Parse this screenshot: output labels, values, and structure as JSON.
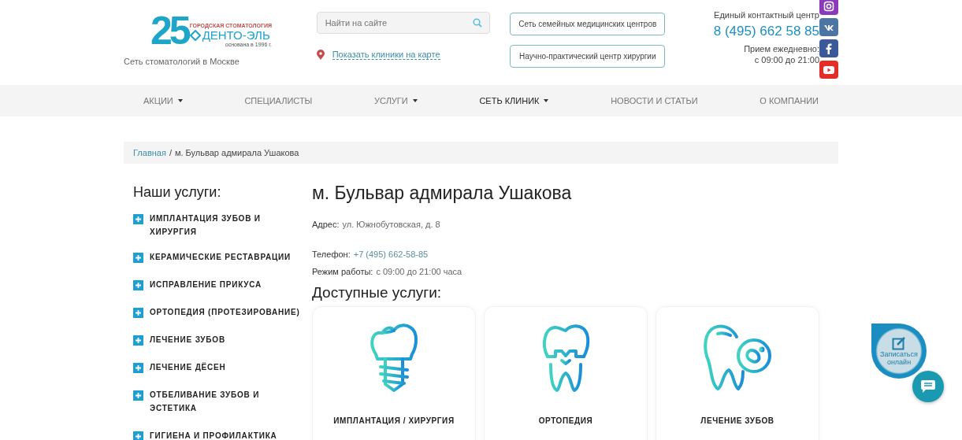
{
  "header": {
    "logo": {
      "number": "25",
      "tagline": "ГОРОДСКАЯ СТОМАТОЛОГИЯ",
      "name": "ДЕНТО-ЭЛЬ",
      "founded": "основана в 1996 г."
    },
    "subtitle": "Сеть стоматологий в Москве",
    "search": {
      "placeholder": "Найти на сайте"
    },
    "map_link": "Показать клиники на карте",
    "center_links": [
      "Сеть семейных медицинских центров",
      "Научно-практический центр хирургии"
    ],
    "contact": {
      "label": "Единый контактный центр",
      "phone": "8 (495) 662 58 85",
      "hours_label": "Прием ежедневно:",
      "hours": "с 09:00 до 21:00"
    },
    "social": [
      {
        "kind": "instagram"
      },
      {
        "kind": "vk"
      },
      {
        "kind": "facebook"
      },
      {
        "kind": "youtube"
      }
    ]
  },
  "nav": [
    {
      "label": "АКЦИИ",
      "dropdown": true,
      "selected": false
    },
    {
      "label": "СПЕЦИАЛИСТЫ",
      "dropdown": false,
      "selected": false
    },
    {
      "label": "УСЛУГИ",
      "dropdown": true,
      "selected": false
    },
    {
      "label": "СЕТЬ КЛИНИК",
      "dropdown": true,
      "selected": true
    },
    {
      "label": "НОВОСТИ И СТАТЬИ",
      "dropdown": false,
      "selected": false
    },
    {
      "label": "О КОМПАНИИ",
      "dropdown": false,
      "selected": false
    }
  ],
  "breadcrumb": {
    "items": [
      {
        "label": "Главная",
        "link": true
      },
      {
        "label": "м. Бульвар адмирала Ушакова",
        "link": false
      }
    ],
    "separator": "/"
  },
  "sidebar": {
    "title": "Наши услуги:",
    "items": [
      "ИМПЛАНТАЦИЯ ЗУБОВ И ХИРУРГИЯ",
      "КЕРАМИЧЕСКИЕ РЕСТАВРАЦИИ",
      "ИСПРАВЛЕНИЕ ПРИКУСА",
      "ОРТОПЕДИЯ (ПРОТЕЗИРОВАНИЕ)",
      "ЛЕЧЕНИЕ ЗУБОВ",
      "ЛЕЧЕНИЕ ДЁСЕН",
      "ОТБЕЛИВАНИЕ ЗУБОВ И ЭСТЕТИКА",
      "ГИГИЕНА И ПРОФИЛАКТИКА"
    ]
  },
  "main": {
    "title": "м. Бульвар адмирала Ушакова",
    "info": [
      {
        "label": "Адрес:",
        "value": "ул. Южнобутовская, д. 8",
        "kind": "text"
      },
      {
        "label": "Телефон:",
        "value": "+7 (495) 662-58-85",
        "kind": "link"
      },
      {
        "label": "Режим работы:",
        "value": "с 09:00 до 21:00 часа",
        "kind": "text"
      }
    ],
    "services_title": "Доступные услуги:",
    "services": [
      {
        "label": "ИМПЛАНТАЦИЯ / ХИРУРГИЯ"
      },
      {
        "label": "ОРТОПЕДИЯ"
      },
      {
        "label": "ЛЕЧЕНИЕ ЗУБОВ"
      }
    ]
  },
  "widget": {
    "label": "Записаться онлайн"
  }
}
